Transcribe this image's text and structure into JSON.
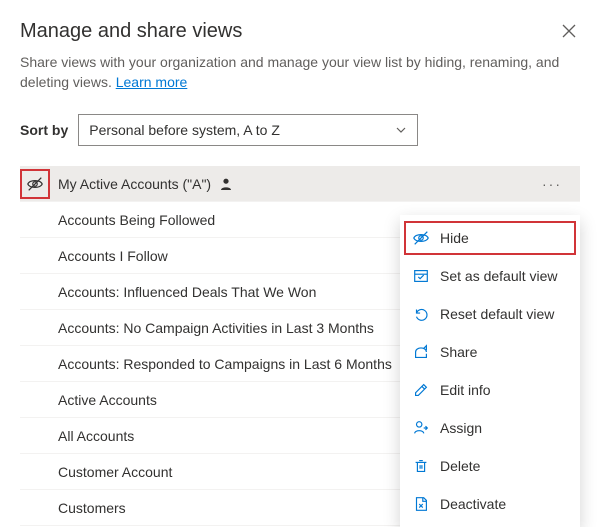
{
  "header": {
    "title": "Manage and share views",
    "close_icon": "close-icon"
  },
  "subtitle": {
    "text_before": "Share views with your organization and manage your view list by hiding, renaming, and deleting views. ",
    "link_text": "Learn more"
  },
  "sort": {
    "label": "Sort by",
    "selected": "Personal before system, A to Z"
  },
  "icons": {
    "hidden_indicator": "eye-hidden-icon"
  },
  "views": {
    "selected_index": 0,
    "items": [
      {
        "label": "My Active Accounts (\"A\")",
        "personal": true
      },
      {
        "label": "Accounts Being Followed"
      },
      {
        "label": "Accounts I Follow"
      },
      {
        "label": "Accounts: Influenced Deals That We Won"
      },
      {
        "label": "Accounts: No Campaign Activities in Last 3 Months"
      },
      {
        "label": "Accounts: Responded to Campaigns in Last 6 Months"
      },
      {
        "label": "Active Accounts"
      },
      {
        "label": "All Accounts"
      },
      {
        "label": "Customer Account"
      },
      {
        "label": "Customers"
      }
    ]
  },
  "menu": {
    "items": [
      {
        "label": "Hide",
        "icon": "eye-hidden-icon",
        "highlighted": true
      },
      {
        "label": "Set as default view",
        "icon": "default-view-icon"
      },
      {
        "label": "Reset default view",
        "icon": "undo-icon"
      },
      {
        "label": "Share",
        "icon": "share-icon"
      },
      {
        "label": "Edit info",
        "icon": "edit-icon"
      },
      {
        "label": "Assign",
        "icon": "assign-icon"
      },
      {
        "label": "Delete",
        "icon": "delete-icon"
      },
      {
        "label": "Deactivate",
        "icon": "deactivate-icon"
      }
    ]
  }
}
